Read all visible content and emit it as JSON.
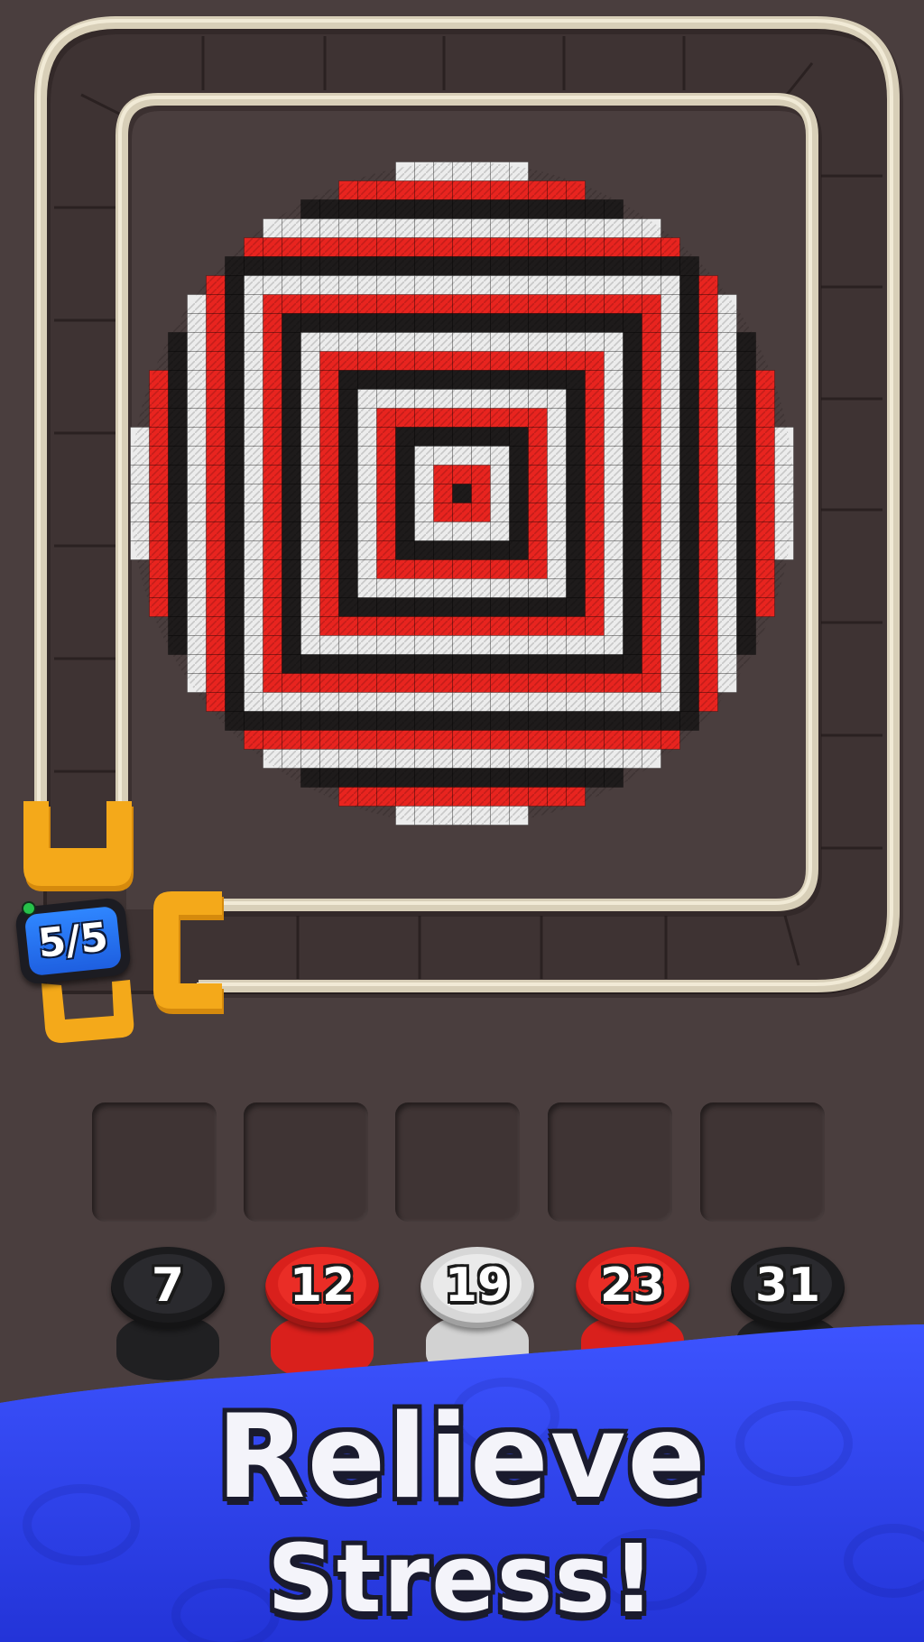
{
  "game": {
    "progress_counter": "5/5",
    "spools": [
      {
        "label": "7",
        "color": "black"
      },
      {
        "label": "12",
        "color": "red"
      },
      {
        "label": "19",
        "color": "white"
      },
      {
        "label": "23",
        "color": "red"
      },
      {
        "label": "31",
        "color": "black"
      }
    ],
    "empty_slots": 5,
    "pattern": {
      "colors": {
        "red": "#e8241f",
        "black": "#1e1b1b",
        "white": "#ececec"
      },
      "style": "concentric square rings in a circular cross-stitch"
    },
    "track_color": "#d8cfb8",
    "clip_color": "#f4a91a"
  },
  "banner": {
    "line1": "Relieve",
    "line2": "Stress!",
    "color": "#2b3ef0"
  },
  "colors": {
    "background": "#4a3e3e",
    "slot": "#3f3434",
    "spool_red": "#d9201c",
    "spool_black": "#1b1b1d",
    "spool_white": "#dedede"
  }
}
